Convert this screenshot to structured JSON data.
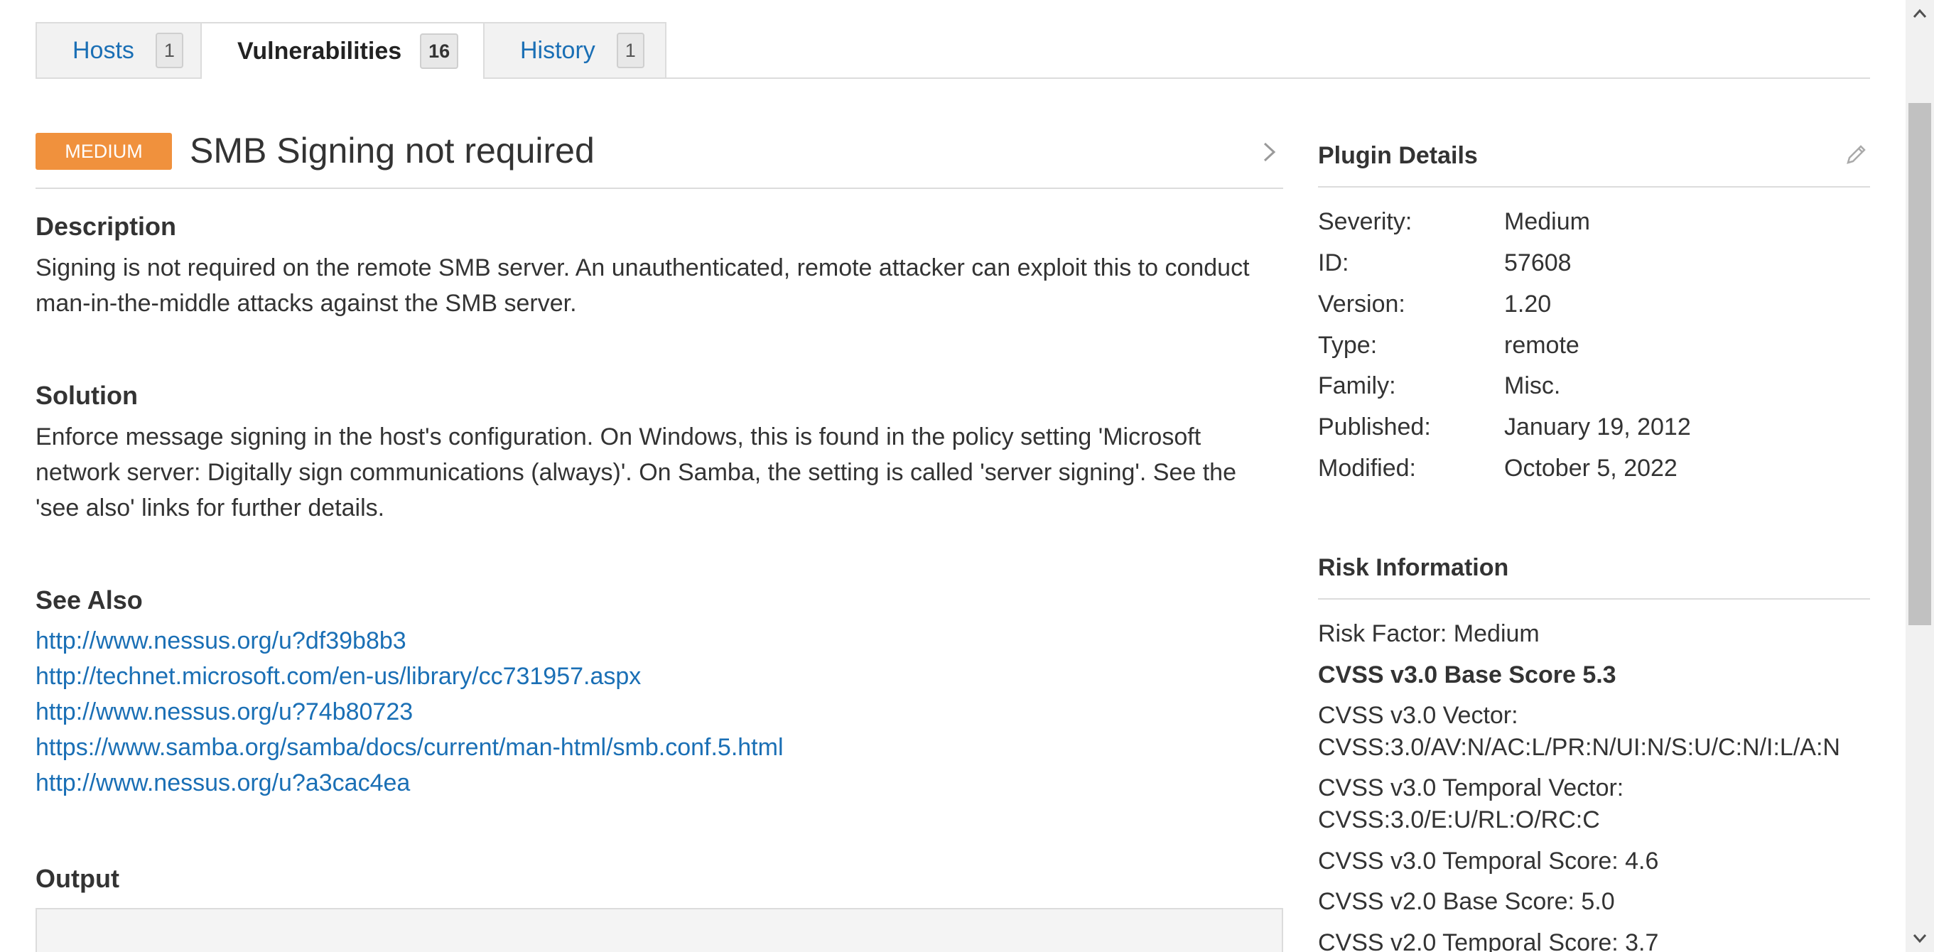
{
  "tabs": [
    {
      "label": "Hosts",
      "count": "1"
    },
    {
      "label": "Vulnerabilities",
      "count": "16"
    },
    {
      "label": "History",
      "count": "1"
    }
  ],
  "vulnerability": {
    "severity": "MEDIUM",
    "title": "SMB Signing not required"
  },
  "description": {
    "heading": "Description",
    "text": "Signing is not required on the remote SMB server. An unauthenticated, remote attacker can exploit this to conduct man-in-the-middle attacks against the SMB server."
  },
  "solution": {
    "heading": "Solution",
    "text": "Enforce message signing in the host's configuration. On Windows, this is found in the policy setting 'Microsoft network server: Digitally sign communications (always)'. On Samba, the setting is called 'server signing'. See the 'see also' links for further details."
  },
  "see_also": {
    "heading": "See Also",
    "links": [
      "http://www.nessus.org/u?df39b8b3",
      "http://technet.microsoft.com/en-us/library/cc731957.aspx",
      "http://www.nessus.org/u?74b80723",
      "https://www.samba.org/samba/docs/current/man-html/smb.conf.5.html",
      "http://www.nessus.org/u?a3cac4ea"
    ]
  },
  "output": {
    "heading": "Output"
  },
  "plugin_details": {
    "heading": "Plugin Details",
    "rows": [
      {
        "key": "Severity:",
        "value": "Medium"
      },
      {
        "key": "ID:",
        "value": "57608"
      },
      {
        "key": "Version:",
        "value": "1.20"
      },
      {
        "key": "Type:",
        "value": "remote"
      },
      {
        "key": "Family:",
        "value": "Misc."
      },
      {
        "key": "Published:",
        "value": "January 19, 2012"
      },
      {
        "key": "Modified:",
        "value": "October 5, 2022"
      }
    ]
  },
  "risk_information": {
    "heading": "Risk Information",
    "risk_factor": "Risk Factor: Medium",
    "cvss3_base": "CVSS v3.0 Base Score 5.3",
    "cvss3_vector": "CVSS v3.0 Vector: CVSS:3.0/AV:N/AC:L/PR:N/UI:N/S:U/C:N/I:L/A:N",
    "cvss3_temporal_vector": "CVSS v3.0 Temporal Vector: CVSS:3.0/E:U/RL:O/RC:C",
    "cvss3_temporal_score": "CVSS v3.0 Temporal Score: 4.6",
    "cvss2_base": "CVSS v2.0 Base Score: 5.0",
    "cvss2_temporal": "CVSS v2.0 Temporal Score: 3.7"
  },
  "colors": {
    "link": "#1a6fb5",
    "severity_medium": "#f0913d",
    "text": "#333333",
    "border": "#dcdcdc"
  },
  "icons": {
    "next": "chevron-right-icon",
    "edit": "pencil-icon",
    "scroll_up": "scroll-up-arrow-icon",
    "scroll_down": "scroll-down-arrow-icon"
  }
}
